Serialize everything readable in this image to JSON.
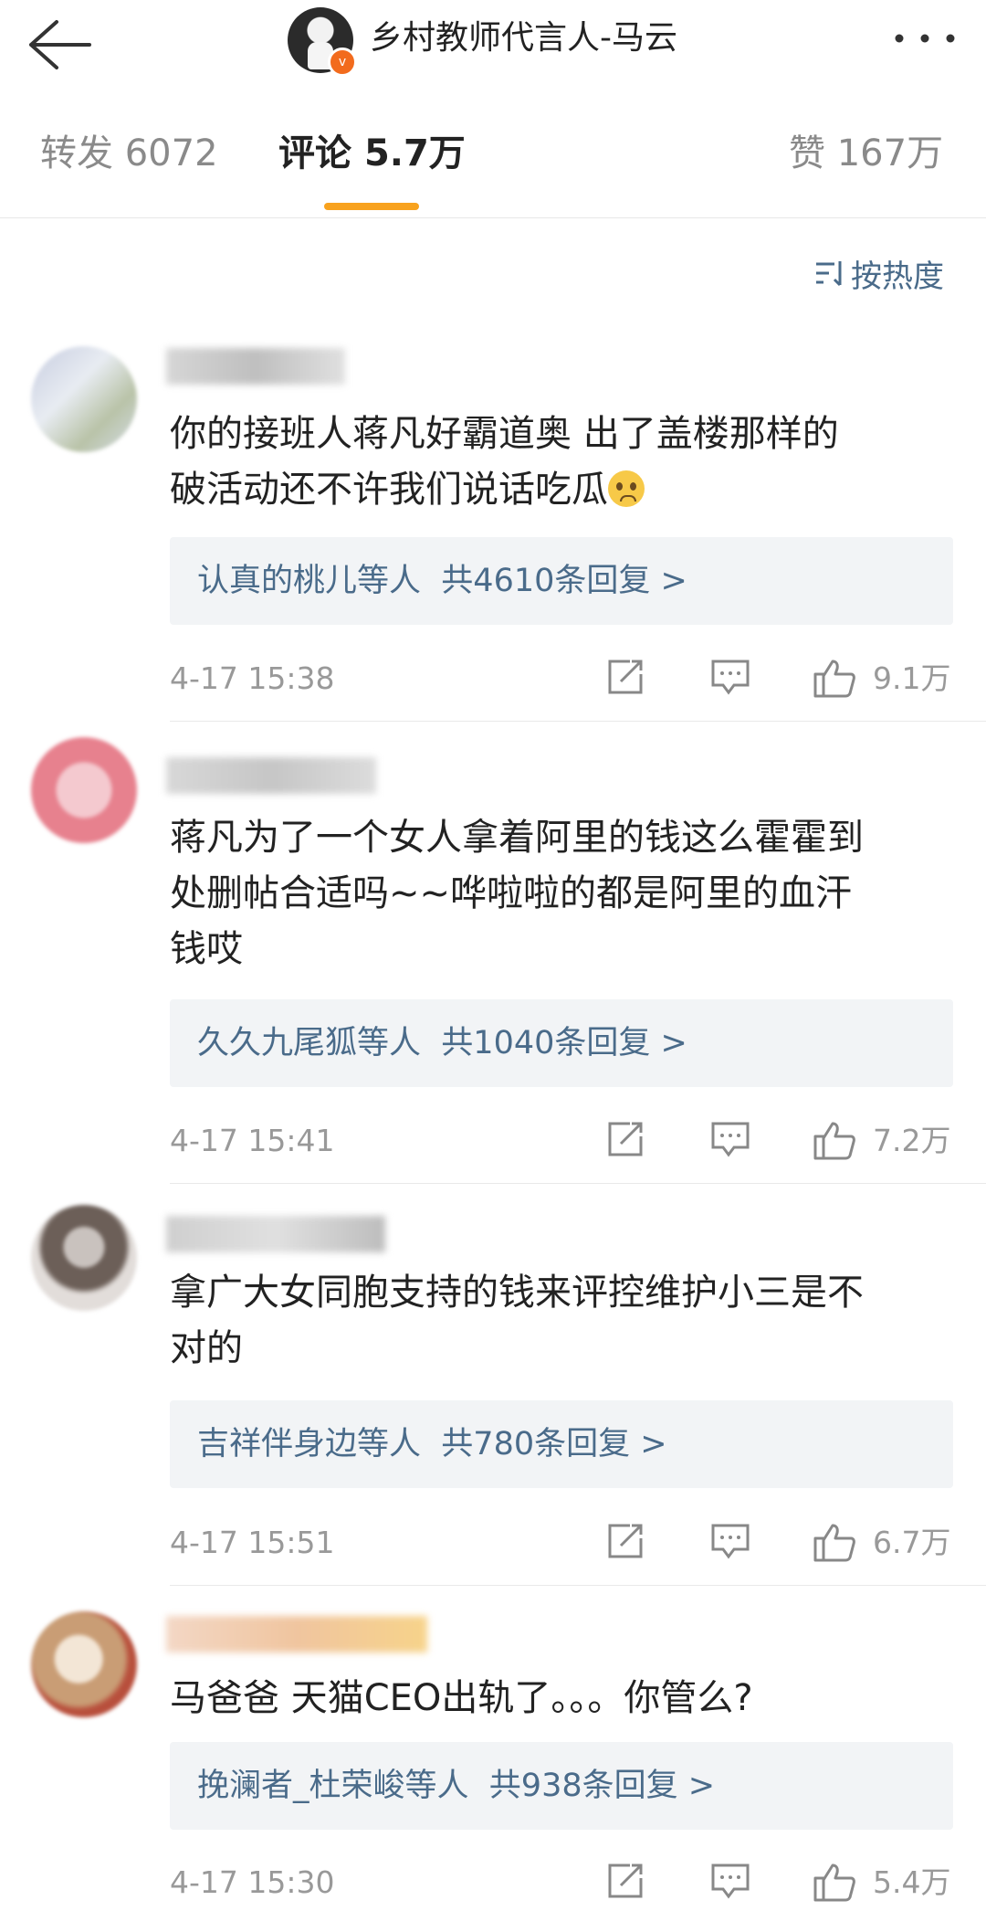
{
  "header": {
    "title": "乡村教师代言人-马云",
    "verified_badge": "v"
  },
  "tabs": [
    {
      "label": "转发",
      "count": "6072"
    },
    {
      "label": "评论",
      "count": "5.7万"
    },
    {
      "label": "赞",
      "count": "167万"
    }
  ],
  "sort": {
    "label": "按热度"
  },
  "comments": [
    {
      "text": "你的接班人蒋凡好霸道奥 出了盖楼那样的破活动还不许我们说话吃瓜",
      "lines": [
        "你的接班人蒋凡好霸道奥 出了盖楼那样的",
        "破活动还不许我们说话吃瓜"
      ],
      "reply_user": "认真的桃儿",
      "reply_suffix": "等人",
      "reply_count": "共4610条回复 >",
      "time": "4-17 15:38",
      "likes": "9.1万"
    },
    {
      "text": "蒋凡为了一个女人拿着阿里的钱这么霍霍到处删帖合适吗~~哗啦啦的都是阿里的血汗钱哎",
      "lines": [
        "蒋凡为了一个女人拿着阿里的钱这么霍霍到",
        "处删帖合适吗~~哗啦啦的都是阿里的血汗",
        "钱哎"
      ],
      "reply_user": "久久九尾狐",
      "reply_suffix": "等人",
      "reply_count": "共1040条回复 >",
      "time": "4-17 15:41",
      "likes": "7.2万"
    },
    {
      "text": "拿广大女同胞支持的钱来评控维护小三是不对的",
      "lines": [
        "拿广大女同胞支持的钱来评控维护小三是不",
        "对的"
      ],
      "reply_user": "吉祥伴身边",
      "reply_suffix": "等人",
      "reply_count": "共780条回复 >",
      "time": "4-17 15:51",
      "likes": "6.7万"
    },
    {
      "text": "马爸爸 天猫CEO出轨了。。。你管么?",
      "lines": [
        "马爸爸  天猫CEO出轨了。。。你管么?"
      ],
      "reply_user": "挽澜者_杜荣峻",
      "reply_suffix": "等人",
      "reply_count": "共938条回复 >",
      "time": "4-17 15:30",
      "likes": "5.4万"
    }
  ]
}
